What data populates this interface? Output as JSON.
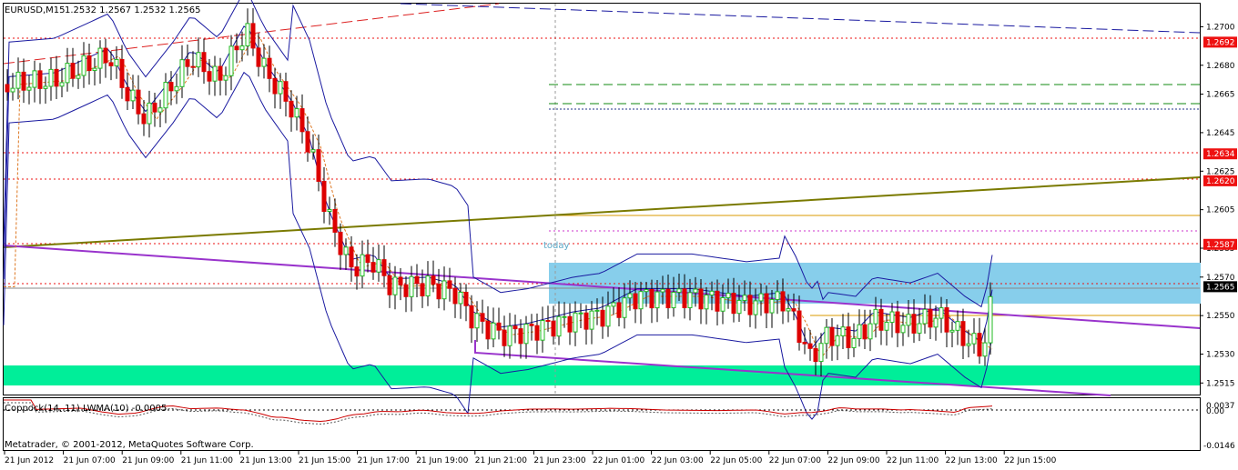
{
  "header": {
    "symbol": "EURUSD,M15",
    "ohlc": "1.2532 1.2567 1.2532 1.2565"
  },
  "indicator": {
    "label": "Coppock(14, 11) LWMA(10) -0.0005",
    "scale": [
      "0.0037",
      "0.00",
      "-0.0146"
    ]
  },
  "copyright": "Metatrader, © 2001-2012, MetaQuotes Software Corp.",
  "annotation_today": "today",
  "price_axis": {
    "ticks": [
      "1.2700",
      "1.2680",
      "1.2665",
      "1.2645",
      "1.2625",
      "1.2605",
      "1.2585",
      "1.2570",
      "1.2550",
      "1.2530",
      "1.2515"
    ],
    "ticks_values": [
      1.27,
      1.268,
      1.2665,
      1.2645,
      1.2625,
      1.2605,
      1.2585,
      1.257,
      1.255,
      1.253,
      1.2515
    ],
    "boxed_levels": [
      {
        "label": "1.2692",
        "value": 1.2692,
        "color": "#ee1111"
      },
      {
        "label": "1.2634",
        "value": 1.2634,
        "color": "#ee1111"
      },
      {
        "label": "1.2620",
        "value": 1.262,
        "color": "#ee1111"
      },
      {
        "label": "1.2587",
        "value": 1.2587,
        "color": "#ee1111"
      }
    ],
    "current_price": {
      "label": "1.2565",
      "value": 1.2565,
      "color": "#000000"
    },
    "range": [
      1.2509,
      1.2712
    ]
  },
  "time_axis": [
    "21 Jun 2012",
    "21 Jun 07:00",
    "21 Jun 09:00",
    "21 Jun 11:00",
    "21 Jun 13:00",
    "21 Jun 15:00",
    "21 Jun 17:00",
    "21 Jun 19:00",
    "21 Jun 21:00",
    "21 Jun 23:00",
    "22 Jun 01:00",
    "22 Jun 03:00",
    "22 Jun 05:00",
    "22 Jun 07:00",
    "22 Jun 09:00",
    "22 Jun 11:00",
    "22 Jun 13:00",
    "22 Jun 15:00"
  ],
  "colors": {
    "bull": "#22bb22",
    "bear": "#dd0000",
    "resistance": "#ee1111",
    "bollinger": "#1a1aa0",
    "trend_olive": "#7a7a00",
    "trend_purple": "#9933cc",
    "zone_blue": "#87ceeb",
    "zone_green": "#00ee99",
    "coppock": "#cc0000"
  }
}
